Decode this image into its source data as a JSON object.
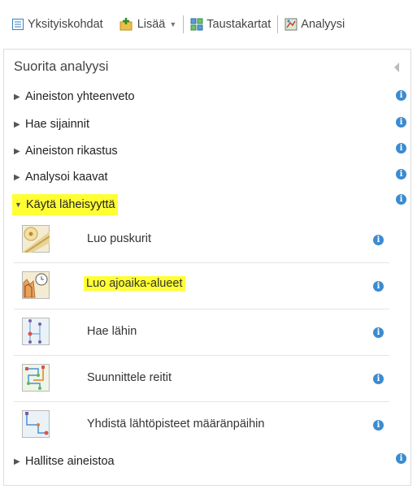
{
  "toolbar": {
    "details_label": "Yksityiskohdat",
    "add_label": "Lisää",
    "basemaps_label": "Taustakartat",
    "analysis_label": "Analyysi"
  },
  "panel": {
    "title": "Suorita analyysi",
    "groups": [
      {
        "label": "Aineiston yhteenveto",
        "expanded": false
      },
      {
        "label": "Hae sijainnit",
        "expanded": false
      },
      {
        "label": "Aineiston rikastus",
        "expanded": false
      },
      {
        "label": "Analysoi kaavat",
        "expanded": false
      },
      {
        "label": "Käytä läheisyyttä",
        "expanded": true,
        "highlighted": true
      },
      {
        "label": "Hallitse aineistoa",
        "expanded": false
      }
    ],
    "tools": [
      {
        "label": "Luo puskurit",
        "icon": "buffer-icon"
      },
      {
        "label": "Luo ajoaika-alueet",
        "icon": "drive-time-icon",
        "highlighted": true
      },
      {
        "label": "Hae lähin",
        "icon": "find-nearest-icon"
      },
      {
        "label": "Suunnittele reitit",
        "icon": "plan-routes-icon"
      },
      {
        "label": "Yhdistä lähtöpisteet määränpäihin",
        "icon": "connect-origins-icon"
      }
    ]
  },
  "colors": {
    "highlight": "#ffff33",
    "info": "#3b8bd0"
  }
}
